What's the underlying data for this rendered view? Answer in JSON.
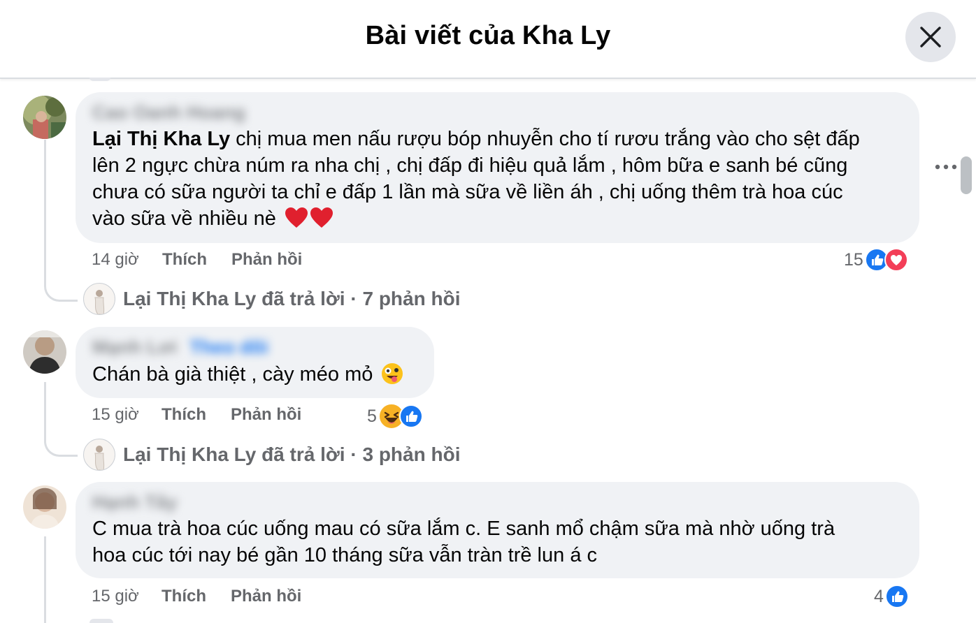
{
  "header": {
    "title": "Bài viết của Kha Ly"
  },
  "comments": [
    {
      "author": "Cao Oanh Hoang",
      "mention": "Lại Thị Kha Ly",
      "lines": [
        " chị mua men nấu rượu bóp nhuyễn cho tí rươu trắng vào cho sệt đấp",
        "lên 2 ngực chừa núm ra nha chị , chị đấp đi hiệu quả lắm , hôm bữa e sanh bé cũng",
        "chưa có sữa người ta chỉ e đấp 1 lần mà sữa về liền áh , chị uống thêm trà hoa cúc",
        "vào sữa về nhiều nè"
      ],
      "time": "14 giờ",
      "like": "Thích",
      "reply": "Phản hồi",
      "reaction_count": "15",
      "reactions": [
        "like-icon",
        "love-icon"
      ],
      "reply_summary": "Lại Thị Kha Ly đã trả lời · 7 phản hồi"
    },
    {
      "author": "Mạnh Lơi",
      "author_extra": "Theo dõi",
      "lines": [
        "Chán bà già thiệt , cày méo mỏ"
      ],
      "time": "15 giờ",
      "like": "Thích",
      "reply": "Phản hồi",
      "reaction_count": "5",
      "reactions": [
        "haha-icon",
        "like-icon"
      ],
      "reply_summary": "Lại Thị Kha Ly đã trả lời · 3 phản hồi"
    },
    {
      "author": "Hạnh Tây",
      "lines": [
        "C mua trà hoa cúc uống mau có sữa lắm c. E sanh mổ chậm sữa mà nhờ uống trà",
        "hoa cúc tới nay bé gần 10 tháng sữa vẫn tràn trề lun á c"
      ],
      "time": "15 giờ",
      "like": "Thích",
      "reply": "Phản hồi",
      "reaction_count": "4",
      "reactions": [
        "like-icon"
      ]
    }
  ],
  "colors": {
    "like_blue": "#1877f2",
    "love_red": "#f33e58",
    "haha_yellow": "#f7b125",
    "bubble_bg": "#f0f2f5",
    "meta_gray": "#65676b"
  }
}
